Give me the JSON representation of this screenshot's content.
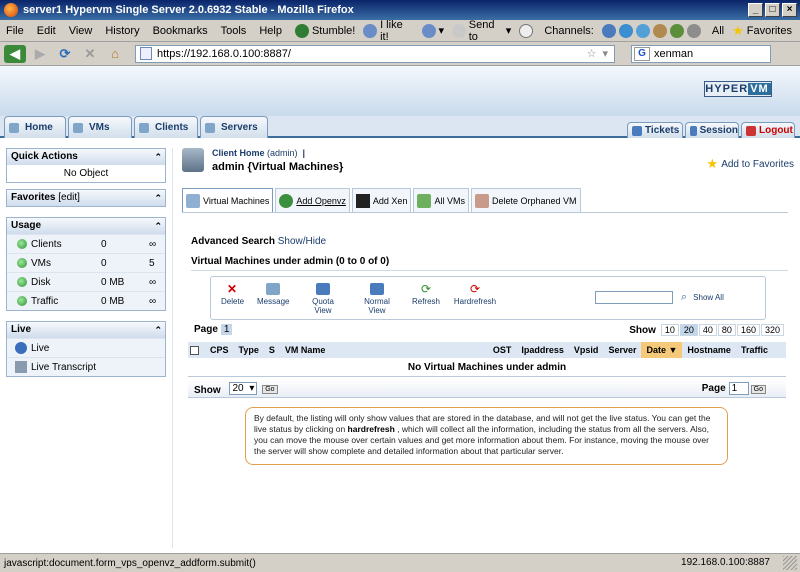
{
  "window": {
    "title": "server1 Hypervm Single Server 2.0.6932 Stable - Mozilla Firefox"
  },
  "menubar": {
    "items": [
      "File",
      "Edit",
      "View",
      "History",
      "Bookmarks",
      "Tools",
      "Help"
    ],
    "stumble": "Stumble!",
    "ilike": "I like it!",
    "sendto": "Send to",
    "channels": "Channels:",
    "all": "All",
    "favorites": "Favorites"
  },
  "nav": {
    "url": "https://192.168.0.100:8887/",
    "search": "xenman"
  },
  "header": {
    "logo": "HYPER",
    "logo2": "VM"
  },
  "tabs": {
    "home": "Home",
    "vms": "VMs",
    "clients": "Clients",
    "servers": "Servers",
    "tickets": "Tickets",
    "session": "Session",
    "logout": "Logout"
  },
  "sidebar": {
    "quick_actions": "Quick Actions",
    "no_object": "No Object",
    "favorites": "Favorites",
    "favorites_edit": "[edit]",
    "usage": "Usage",
    "usage_rows": [
      {
        "name": "Clients",
        "v1": "0",
        "v2": "∞"
      },
      {
        "name": "VMs",
        "v1": "0",
        "v2": "5"
      },
      {
        "name": "Disk",
        "v1": "0 MB",
        "v2": "∞"
      },
      {
        "name": "Traffic",
        "v1": "0 MB",
        "v2": "∞"
      }
    ],
    "live": "Live",
    "live_items": [
      "Live",
      "Live Transcript"
    ]
  },
  "main": {
    "client_home": "Client Home",
    "client_home_user": "(admin)",
    "client_title": "admin {Virtual Machines}",
    "add_favorites": "Add to Favorites",
    "subtabs": [
      "Virtual Machines",
      "Add Openvz",
      "Add Xen",
      "All VMs",
      "Delete Orphaned VM"
    ],
    "adv_search": "Advanced Search",
    "show_hide": "Show/Hide",
    "vm_heading": "Virtual Machines under admin (0 to 0 of 0)",
    "actions": [
      "Delete",
      "Message",
      "Quota View",
      "Normal View",
      "Refresh",
      "Hardrefresh"
    ],
    "show_all": "Show All",
    "page_label": "Page",
    "page_num": "1",
    "show_label": "Show",
    "page_sizes": [
      "10",
      "20",
      "40",
      "80",
      "160",
      "320"
    ],
    "columns": [
      "CPS",
      "Type",
      "S",
      "VM Name",
      "OST",
      "Ipaddress",
      "Vpsid",
      "Server",
      "Date",
      "Hostname",
      "Traffic"
    ],
    "empty_msg": "No Virtual Machines under admin",
    "show_select": "20",
    "go": "Go",
    "page_input": "1",
    "info_text_1": "By default, the listing will only show values that are stored in the database, and will not get the live status. You can get the live status by clicking on ",
    "info_bold": "hardrefresh",
    "info_text_2": " , which will collect all the information, including the status from all the servers. Also, you can move the mouse over certain values and get more information about them. For instance, moving the mouse over the server will show complete and detailed information about that particular server."
  },
  "status": {
    "left": "javascript:document.form_vps_openvz_addform.submit()",
    "right": "192.168.0.100:8887"
  }
}
